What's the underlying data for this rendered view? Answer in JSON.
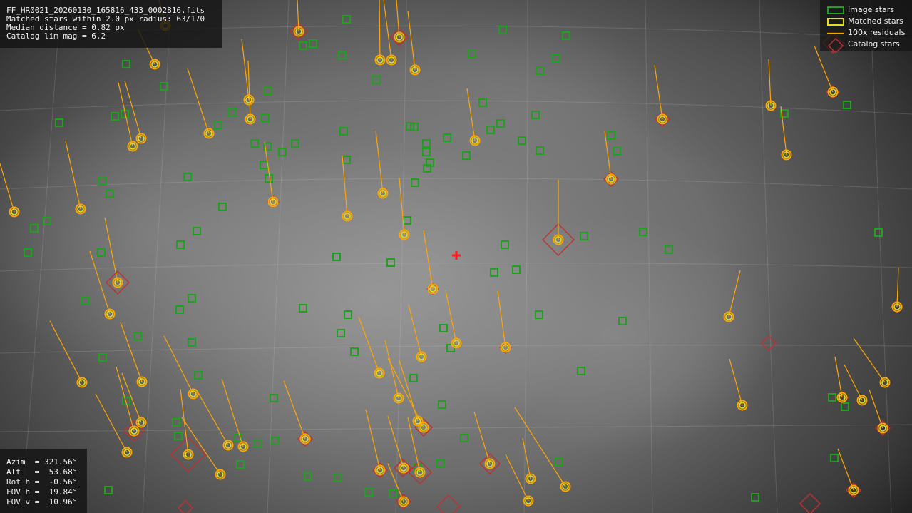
{
  "info": {
    "filename": "FF_HR0021_20260130_165816_433_0002816.fits",
    "matched": "Matched stars within 2.0 px radius: 63/170",
    "median": "Median distance = 0.82 px",
    "catalog": "Catalog lim mag = 6.2"
  },
  "legend": {
    "image_stars": "Image stars",
    "matched_stars": "Matched stars",
    "residuals": "100x residuals",
    "catalog_stars": "Catalog stars"
  },
  "pointing": {
    "azim": "Azim  = 321.56°",
    "alt": "Alt   =  53.68°",
    "rot": "Rot h =  -0.56°",
    "fov_h": "FOV h =  19.84°",
    "fov_v": "FOV v =  10.96°"
  },
  "colors": {
    "image_star": "#1fa01f",
    "matched_star": "#e0e020",
    "residual": "#ffa500",
    "catalog_star": "#c03030",
    "center_marker": "#ff1a1a"
  }
}
